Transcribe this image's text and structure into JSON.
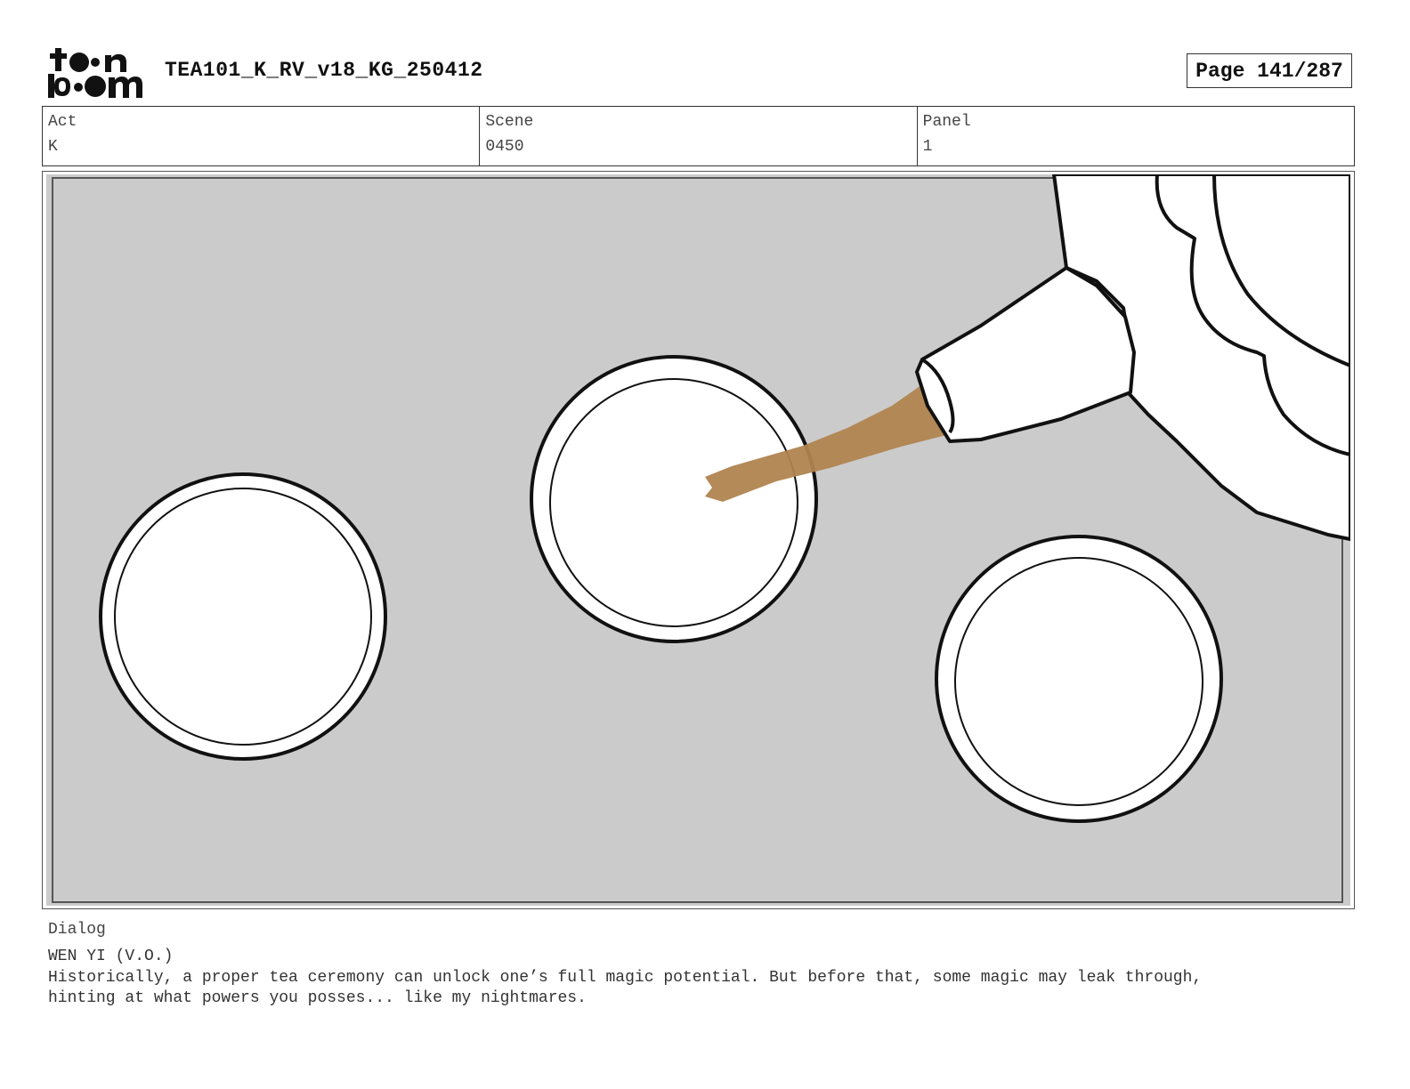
{
  "header": {
    "logo_text": "toon boom",
    "title": "TEA101_K_RV_v18_KG_250412",
    "page_label": "Page 141/287"
  },
  "info": {
    "act": {
      "label": "Act",
      "value": "K"
    },
    "scene": {
      "label": "Scene",
      "value": "0450"
    },
    "panel": {
      "label": "Panel",
      "value": "1"
    }
  },
  "panel_image": {
    "description_icon": "storyboard-drawing",
    "background_color": "#cbcbcb",
    "tea_color": "#b0844f"
  },
  "dialog": {
    "label": "Dialog",
    "character": "WEN YI (V.O.)",
    "text": "Historically, a proper tea ceremony can unlock one’s full magic potential. But before that, some magic may leak through,\nhinting at what powers you posses... like my nightmares."
  }
}
